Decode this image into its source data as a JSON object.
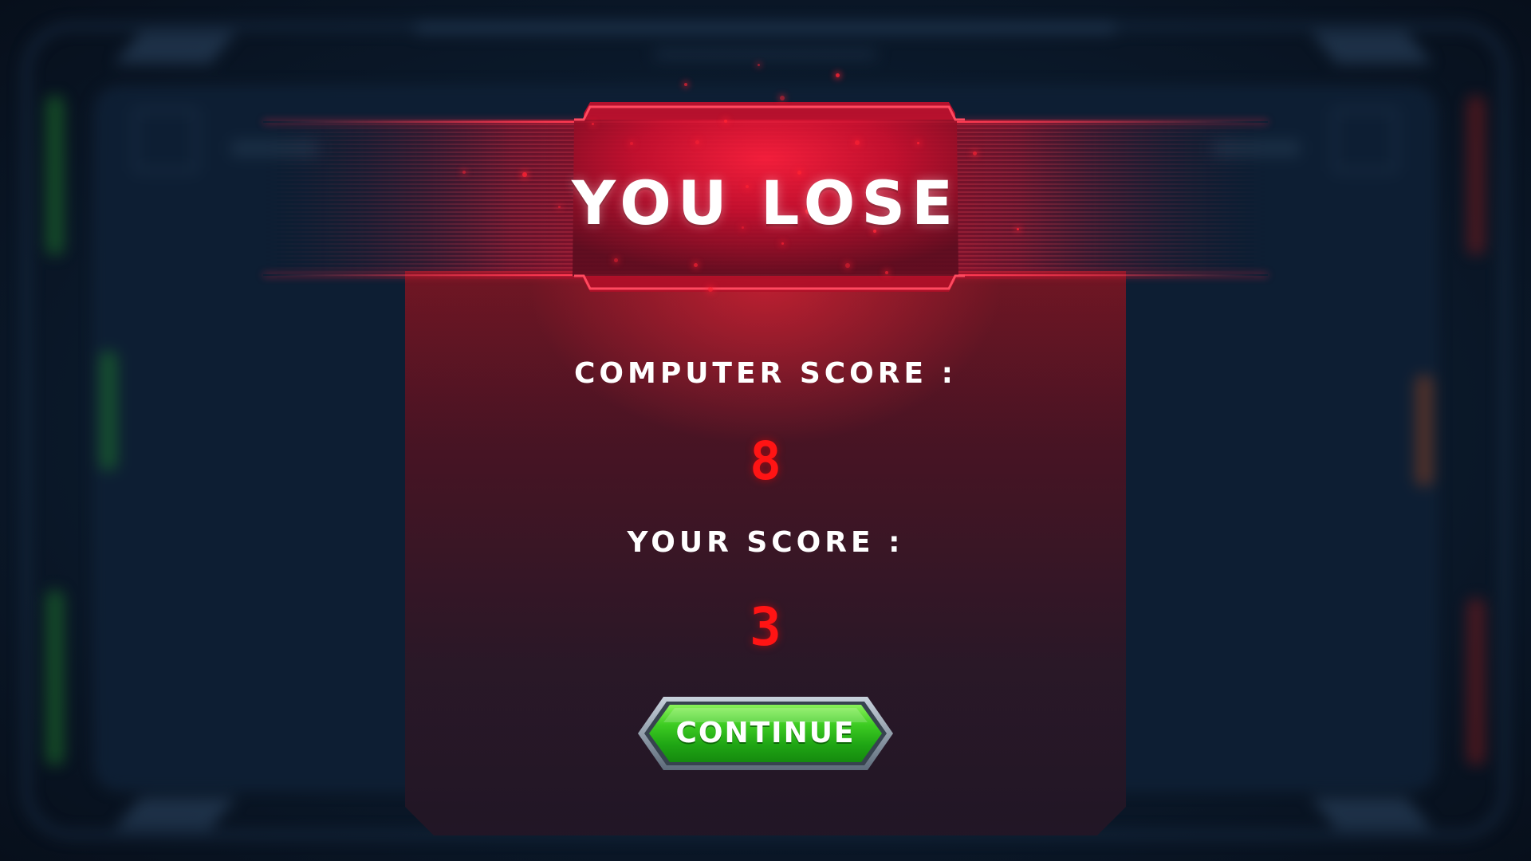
{
  "result_title": "YOU LOSE",
  "computer_score": {
    "label": "COMPUTER SCORE :",
    "value": "8"
  },
  "player_score": {
    "label": "YOUR SCORE :",
    "value": "3"
  },
  "continue_button": {
    "label": "CONTINUE"
  },
  "colors": {
    "accent_red": "#ff1414",
    "banner_red": "#e0122e",
    "button_green": "#2fb81a",
    "background": "#0b1a2c"
  },
  "icons": [
    "spark-particles"
  ]
}
